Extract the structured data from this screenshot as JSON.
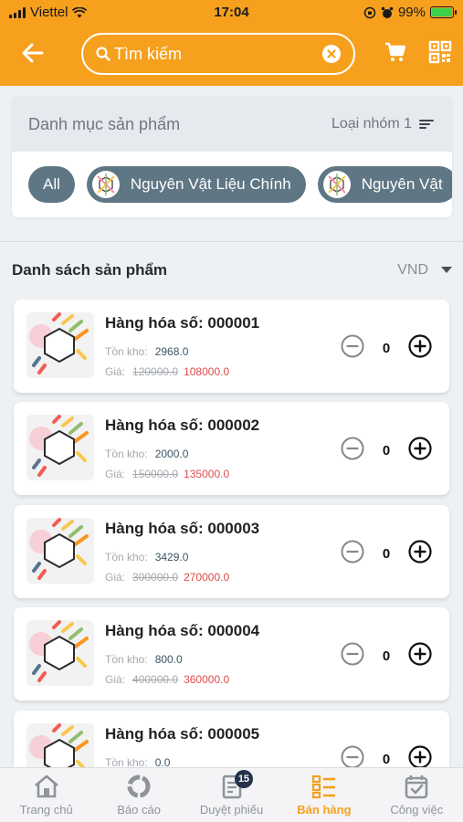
{
  "status_bar": {
    "carrier": "Viettel",
    "time": "17:04",
    "battery": "99%"
  },
  "header": {
    "search_placeholder": "Tìm kiếm",
    "accent_color": "#f6a01e"
  },
  "category": {
    "title": "Danh mục sản phẩm",
    "filter_label": "Loại nhóm 1",
    "chips": [
      "All",
      "Nguyên Vật Liệu Chính",
      "Nguyên Vật"
    ]
  },
  "list": {
    "title": "Danh sách sản phẩm",
    "currency": "VND",
    "stock_label": "Tồn kho:",
    "price_label": "Giá:"
  },
  "products": [
    {
      "name": "Hàng hóa số: 000001",
      "stock": "2968.0",
      "old_price": "120000.0",
      "price": "108000.0",
      "qty": "0"
    },
    {
      "name": "Hàng hóa số: 000002",
      "stock": "2000.0",
      "old_price": "150000.0",
      "price": "135000.0",
      "qty": "0"
    },
    {
      "name": "Hàng hóa số: 000003",
      "stock": "3429.0",
      "old_price": "300000.0",
      "price": "270000.0",
      "qty": "0"
    },
    {
      "name": "Hàng hóa số: 000004",
      "stock": "800.0",
      "old_price": "400000.0",
      "price": "360000.0",
      "qty": "0"
    },
    {
      "name": "Hàng hóa số: 000005",
      "stock": "0.0",
      "old_price": "",
      "price": "",
      "qty": "0"
    }
  ],
  "bottom_nav": [
    {
      "label": "Trang chủ",
      "icon": "home-icon"
    },
    {
      "label": "Báo cáo",
      "icon": "report-icon"
    },
    {
      "label": "Duyệt phiếu",
      "icon": "approve-icon",
      "badge": "15"
    },
    {
      "label": "Bán hàng",
      "icon": "sales-icon",
      "active": true
    },
    {
      "label": "Công việc",
      "icon": "task-icon"
    }
  ]
}
